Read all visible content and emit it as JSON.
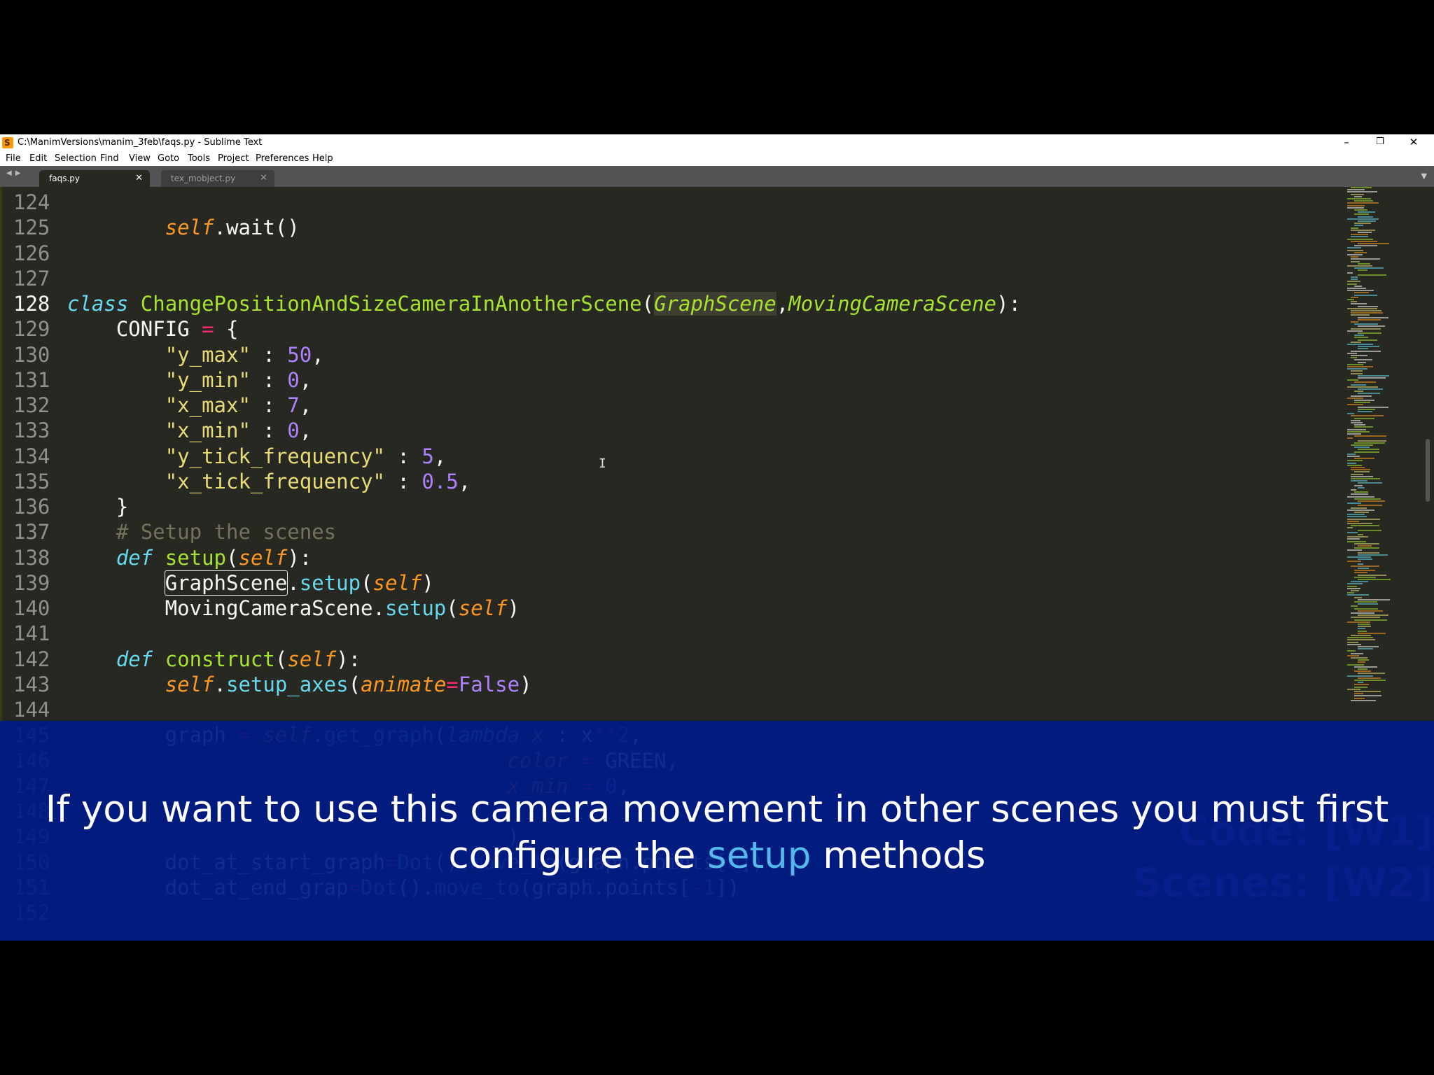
{
  "window": {
    "title": "C:\\ManimVersions\\manim_3feb\\faqs.py - Sublime Text",
    "controls": {
      "minimize": "–",
      "restore": "❐",
      "close": "✕"
    }
  },
  "menu": [
    "File",
    "Edit",
    "Selection",
    "Find",
    "View",
    "Goto",
    "Tools",
    "Project",
    "Preferences",
    "Help"
  ],
  "tabs": [
    {
      "label": "faqs.py",
      "active": true,
      "close": "✕"
    },
    {
      "label": "tex_mobject.py",
      "active": false,
      "close": "✕"
    }
  ],
  "tab_nav": "◀▶",
  "tab_dropdown": "▼",
  "editor": {
    "cursor_glyph": "I",
    "current_line": 128,
    "lines": [
      {
        "n": "124",
        "tokens": []
      },
      {
        "n": "125",
        "tokens": [
          [
            "w",
            "        "
          ],
          [
            "slf",
            "self"
          ],
          [
            "w",
            ".wait()"
          ]
        ]
      },
      {
        "n": "126",
        "tokens": []
      },
      {
        "n": "127",
        "tokens": []
      },
      {
        "n": "128",
        "tokens": [
          [
            "kw",
            "class"
          ],
          [
            "w",
            " "
          ],
          [
            "cls",
            "ChangePositionAndSizeCameraInAnotherScene"
          ],
          [
            "w",
            "("
          ],
          [
            "inh hlbg",
            "GraphScene"
          ],
          [
            "w",
            ","
          ],
          [
            "inh",
            "MovingCameraScene"
          ],
          [
            "w",
            "):"
          ]
        ]
      },
      {
        "n": "129",
        "tokens": [
          [
            "w",
            "    CONFIG "
          ],
          [
            "op",
            "="
          ],
          [
            "w",
            " {"
          ]
        ]
      },
      {
        "n": "130",
        "tokens": [
          [
            "w",
            "        "
          ],
          [
            "str",
            "\"y_max\""
          ],
          [
            "w",
            " : "
          ],
          [
            "num",
            "50"
          ],
          [
            "w",
            ","
          ]
        ]
      },
      {
        "n": "131",
        "tokens": [
          [
            "w",
            "        "
          ],
          [
            "str",
            "\"y_min\""
          ],
          [
            "w",
            " : "
          ],
          [
            "num",
            "0"
          ],
          [
            "w",
            ","
          ]
        ]
      },
      {
        "n": "132",
        "tokens": [
          [
            "w",
            "        "
          ],
          [
            "str",
            "\"x_max\""
          ],
          [
            "w",
            " : "
          ],
          [
            "num",
            "7"
          ],
          [
            "w",
            ","
          ]
        ]
      },
      {
        "n": "133",
        "tokens": [
          [
            "w",
            "        "
          ],
          [
            "str",
            "\"x_min\""
          ],
          [
            "w",
            " : "
          ],
          [
            "num",
            "0"
          ],
          [
            "w",
            ","
          ]
        ]
      },
      {
        "n": "134",
        "tokens": [
          [
            "w",
            "        "
          ],
          [
            "str",
            "\"y_tick_frequency\""
          ],
          [
            "w",
            " : "
          ],
          [
            "num",
            "5"
          ],
          [
            "w",
            ","
          ]
        ]
      },
      {
        "n": "135",
        "tokens": [
          [
            "w",
            "        "
          ],
          [
            "str",
            "\"x_tick_frequency\""
          ],
          [
            "w",
            " : "
          ],
          [
            "num",
            "0.5"
          ],
          [
            "w",
            ","
          ]
        ]
      },
      {
        "n": "136",
        "tokens": [
          [
            "w",
            "    }"
          ]
        ]
      },
      {
        "n": "137",
        "tokens": [
          [
            "w",
            "    "
          ],
          [
            "cmt",
            "# Setup the scenes"
          ]
        ]
      },
      {
        "n": "138",
        "tokens": [
          [
            "w",
            "    "
          ],
          [
            "kw",
            "def"
          ],
          [
            "w",
            " "
          ],
          [
            "fd",
            "setup"
          ],
          [
            "w",
            "("
          ],
          [
            "slf",
            "self"
          ],
          [
            "w",
            "):"
          ]
        ]
      },
      {
        "n": "139",
        "tokens": [
          [
            "w",
            "        "
          ],
          [
            "w box",
            "GraphScene"
          ],
          [
            "w",
            "."
          ],
          [
            "fn",
            "setup"
          ],
          [
            "w",
            "("
          ],
          [
            "slf",
            "self"
          ],
          [
            "w",
            ")"
          ]
        ]
      },
      {
        "n": "140",
        "tokens": [
          [
            "w",
            "        MovingCameraScene."
          ],
          [
            "fn",
            "setup"
          ],
          [
            "w",
            "("
          ],
          [
            "slf",
            "self"
          ],
          [
            "w",
            ")"
          ]
        ]
      },
      {
        "n": "141",
        "tokens": []
      },
      {
        "n": "142",
        "tokens": [
          [
            "w",
            "    "
          ],
          [
            "kw",
            "def"
          ],
          [
            "w",
            " "
          ],
          [
            "fd",
            "construct"
          ],
          [
            "w",
            "("
          ],
          [
            "slf",
            "self"
          ],
          [
            "w",
            "):"
          ]
        ]
      },
      {
        "n": "143",
        "tokens": [
          [
            "w",
            "        "
          ],
          [
            "slf",
            "self"
          ],
          [
            "w",
            "."
          ],
          [
            "fn",
            "setup_axes"
          ],
          [
            "w",
            "("
          ],
          [
            "slf",
            "animate"
          ],
          [
            "op",
            "="
          ],
          [
            "num",
            "False"
          ],
          [
            "w",
            ")"
          ]
        ]
      },
      {
        "n": "144",
        "tokens": []
      },
      {
        "n": "145",
        "tokens": [
          [
            "w",
            "        graph "
          ],
          [
            "op",
            "="
          ],
          [
            "w",
            " "
          ],
          [
            "slf",
            "self"
          ],
          [
            "w",
            "."
          ],
          [
            "fn",
            "get_graph"
          ],
          [
            "w",
            "("
          ],
          [
            "kw",
            "lambda"
          ],
          [
            "w",
            " "
          ],
          [
            "slf",
            "x"
          ],
          [
            "w",
            " : x"
          ],
          [
            "op",
            "**"
          ],
          [
            "num",
            "2"
          ],
          [
            "w",
            ","
          ]
        ]
      },
      {
        "n": "146",
        "tokens": [
          [
            "w",
            "                                    "
          ],
          [
            "slf",
            "color"
          ],
          [
            "w",
            " "
          ],
          [
            "op",
            "="
          ],
          [
            "w",
            " GREEN,"
          ]
        ]
      },
      {
        "n": "147",
        "tokens": [
          [
            "w",
            "                                    "
          ],
          [
            "slf",
            "x_min"
          ],
          [
            "w",
            " "
          ],
          [
            "op",
            "="
          ],
          [
            "w",
            " "
          ],
          [
            "num",
            "0"
          ],
          [
            "w",
            ","
          ]
        ]
      },
      {
        "n": "148",
        "tokens": []
      },
      {
        "n": "149",
        "tokens": [
          [
            "w",
            "                                    )"
          ]
        ]
      },
      {
        "n": "150",
        "tokens": [
          [
            "w",
            "        dot_at_start_graph"
          ],
          [
            "op",
            "="
          ],
          [
            "fn",
            "Dot"
          ],
          [
            "w",
            "()."
          ],
          [
            "fn",
            "move_to"
          ],
          [
            "w",
            "(graph.points["
          ],
          [
            "num",
            "0"
          ],
          [
            "w",
            "])"
          ]
        ]
      },
      {
        "n": "151",
        "tokens": [
          [
            "w",
            "        dot_at_end_grap"
          ],
          [
            "op",
            "="
          ],
          [
            "fn",
            "Dot"
          ],
          [
            "w",
            "()."
          ],
          [
            "fn",
            "move_to"
          ],
          [
            "w",
            "(graph.points["
          ],
          [
            "op",
            "-"
          ],
          [
            "num",
            "1"
          ],
          [
            "w",
            "])"
          ]
        ]
      },
      {
        "n": "152",
        "tokens": []
      }
    ]
  },
  "caption": {
    "line1": "If you want to use this camera movement in other scenes you must first",
    "line2_before": "configure the ",
    "line2_highlight": "setup",
    "line2_after": " methods"
  },
  "watermark": {
    "line1": "Code: [W1]",
    "line2": "Scenes: [W2]"
  },
  "colors": {
    "background": "#272822",
    "keyword": "#66d9ef",
    "class_name": "#a6e22e",
    "self": "#fd971f",
    "string": "#e6db74",
    "number": "#ae81ff",
    "operator": "#f92672",
    "comment": "#75715e",
    "overlay": "#001b87",
    "caption_highlight": "#55b8ea"
  }
}
